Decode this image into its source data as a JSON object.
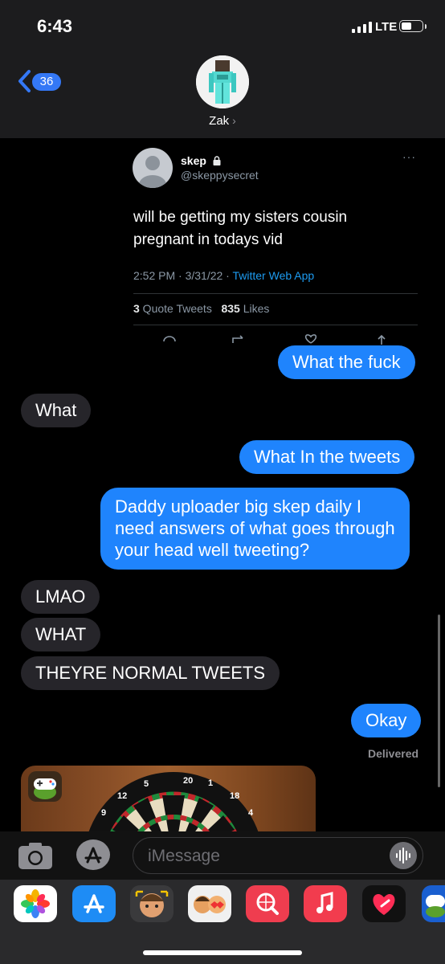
{
  "status_bar": {
    "time": "6:43",
    "network": "LTE"
  },
  "header": {
    "back_badge": "36",
    "contact_name": "Zak"
  },
  "tweet": {
    "name": "skep",
    "handle": "@skeppysecret",
    "more": "···",
    "text": "will be getting my sisters cousin pregnant in todays vid",
    "timestamp": "2:52 PM · 3/31/22 · ",
    "source": "Twitter Web App",
    "quote_count": "3",
    "quote_label": " Quote Tweets",
    "like_count": "835",
    "like_label": " Likes"
  },
  "messages": [
    {
      "from": "me",
      "text": "What the fuck"
    },
    {
      "from": "them",
      "text": "What"
    },
    {
      "from": "me",
      "text": "What In the tweets"
    },
    {
      "from": "me",
      "text": "Daddy uploader big skep daily I\nneed answers of what goes through\nyour head well tweeting?"
    },
    {
      "from": "them",
      "text": "LMAO"
    },
    {
      "from": "them",
      "text": "WHAT"
    },
    {
      "from": "them",
      "text": "THEYRE NORMAL TWEETS"
    },
    {
      "from": "me",
      "text": "Okay"
    }
  ],
  "delivered": "Delivered",
  "game_card": {
    "board_numbers": [
      "5",
      "20",
      "1",
      "12",
      "18",
      "9",
      "4"
    ]
  },
  "input": {
    "placeholder": "iMessage"
  },
  "app_drawer": [
    "photos-icon",
    "app-store-icon",
    "memoji-icon",
    "memoji-stickers-icon",
    "web-search-icon",
    "music-icon",
    "heart-icon",
    "gamepigeon-icon"
  ],
  "colors": {
    "outgoing_bubble": "#1f84fd",
    "incoming_bubble": "#26252a",
    "accent": "#3478f6",
    "twitter_link": "#1d9bf0"
  }
}
